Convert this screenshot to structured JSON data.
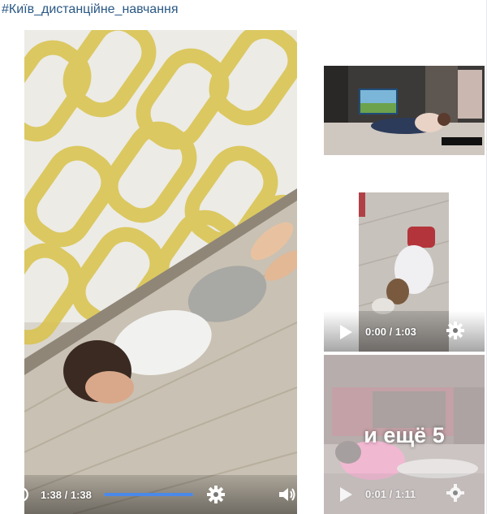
{
  "post": {
    "hashtag": "#Київ_дистанційне_навчання"
  },
  "main_video": {
    "time": "1:38 / 1:38",
    "progress": 1.0,
    "replay_icon": "replay-icon",
    "settings_icon": "gear-icon",
    "volume_icon": "volume-icon"
  },
  "thumbnails": [
    {
      "kind": "photo",
      "description_icon": "image"
    },
    {
      "kind": "video",
      "time": "0:00 / 1:03",
      "play_icon": "play-icon",
      "settings_icon": "gear-icon"
    },
    {
      "kind": "video",
      "time": "0:01 / 1:11",
      "play_icon": "play-icon",
      "settings_icon": "gear-icon",
      "more_label": "и ещё 5"
    }
  ],
  "colors": {
    "link": "#2a5885",
    "progress": "#4a89e8"
  }
}
